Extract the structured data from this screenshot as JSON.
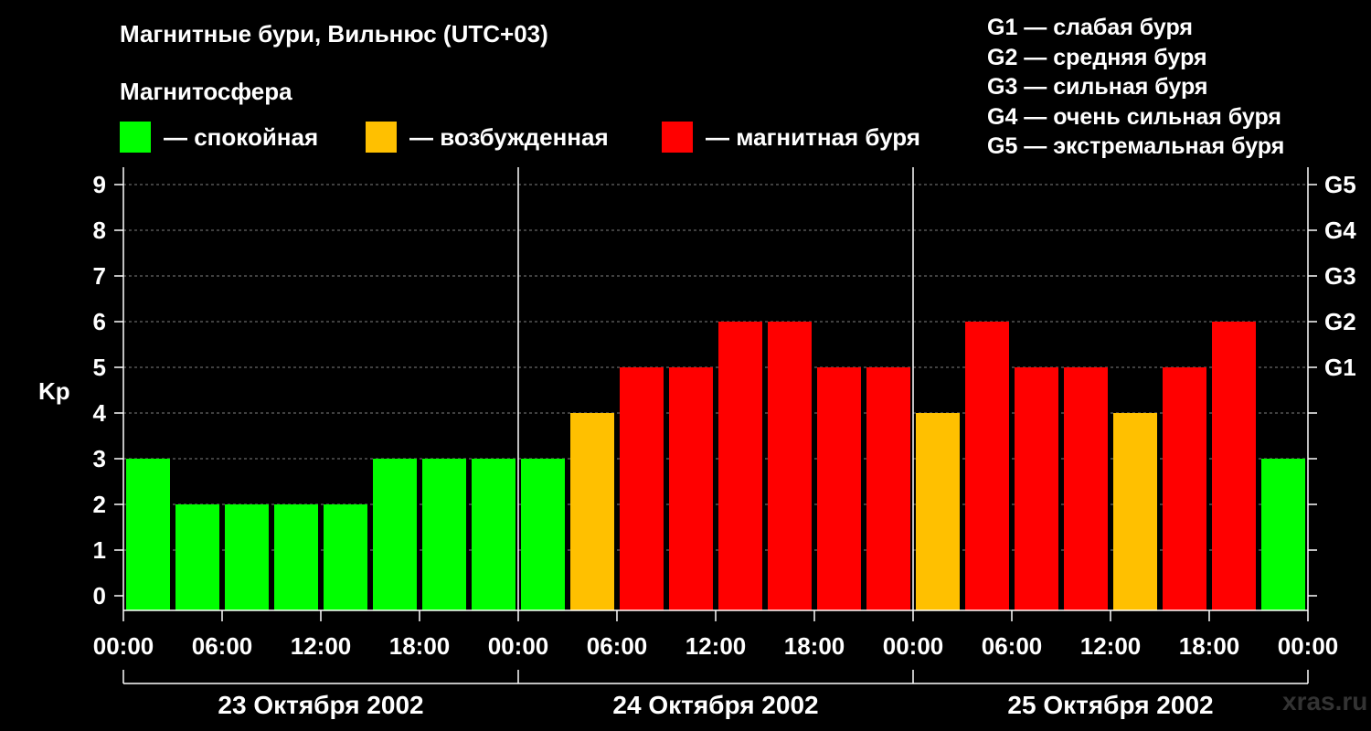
{
  "title": "Магнитные бури, Вильнюс (UTC+03)",
  "subtitle": "Магнитосфера",
  "legend": [
    {
      "label": "— спокойная",
      "color": "#00ff00"
    },
    {
      "label": "— возбужденная",
      "color": "#ffc000"
    },
    {
      "label": "— магнитная буря",
      "color": "#ff0000"
    }
  ],
  "g_scale": [
    "G1 — слабая буря",
    "G2 — средняя буря",
    "G3 — сильная буря",
    "G4 — очень сильная буря",
    "G5 — экстремальная буря"
  ],
  "watermark": "xras.ru",
  "colors": {
    "quiet": "#00ff00",
    "active": "#ffc000",
    "storm": "#ff0000",
    "background": "#000000",
    "axis": "#ffffff",
    "grid": "#808080"
  },
  "chart_data": {
    "type": "bar",
    "ylabel": "Kp",
    "ylim": [
      0,
      9
    ],
    "yticks": [
      "0",
      "1",
      "2",
      "3",
      "4",
      "5",
      "6",
      "7",
      "8",
      "9"
    ],
    "right_ticks": [
      {
        "value": 5,
        "label": "G1"
      },
      {
        "value": 6,
        "label": "G2"
      },
      {
        "value": 7,
        "label": "G3"
      },
      {
        "value": 8,
        "label": "G4"
      },
      {
        "value": 9,
        "label": "G5"
      }
    ],
    "xticks": [
      "00:00",
      "06:00",
      "12:00",
      "18:00",
      "00:00",
      "06:00",
      "12:00",
      "18:00",
      "00:00",
      "06:00",
      "12:00",
      "18:00",
      "00:00"
    ],
    "days": [
      "23 Октября 2002",
      "24 Октября 2002",
      "25 Октября 2002"
    ],
    "grid": true,
    "values": [
      3,
      2,
      2,
      2,
      2,
      3,
      3,
      3,
      3,
      4,
      5,
      5,
      6,
      6,
      5,
      5,
      4,
      6,
      5,
      5,
      4,
      5,
      6,
      3
    ]
  }
}
